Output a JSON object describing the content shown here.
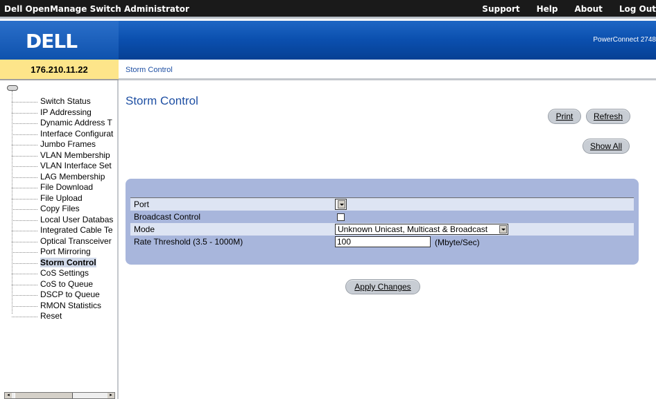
{
  "app": {
    "title": "Dell OpenManage Switch Administrator",
    "top_links": [
      "Support",
      "Help",
      "About",
      "Log Out"
    ],
    "logo": "DELL",
    "product": "PowerConnect 2748"
  },
  "device_ip": "176.210.11.22",
  "breadcrumb": "Storm Control",
  "nav": {
    "items": [
      "Switch Status",
      "IP Addressing",
      "Dynamic Address T",
      "Interface Configurat",
      "Jumbo Frames",
      "VLAN Membership",
      "VLAN Interface Set",
      "LAG Membership",
      "File Download",
      "File Upload",
      "Copy Files",
      "Local User Databas",
      "Integrated Cable Te",
      "Optical Transceiver",
      "Port Mirroring",
      "Storm Control",
      "CoS Settings",
      "CoS to Queue",
      "DSCP to Queue",
      "RMON Statistics",
      "Reset"
    ],
    "active": "Storm Control"
  },
  "main": {
    "title": "Storm Control",
    "buttons": {
      "print": "Print",
      "refresh": "Refresh",
      "show_all": "Show All",
      "apply": "Apply Changes"
    },
    "form": {
      "port_label": "Port",
      "port_value": "",
      "broadcast_label": "Broadcast Control",
      "broadcast_checked": false,
      "mode_label": "Mode",
      "mode_value": "Unknown Unicast, Multicast & Broadcast",
      "rate_label": "Rate Threshold (3.5 - 1000M)",
      "rate_value": "100",
      "rate_unit": "(Mbyte/Sec)"
    }
  },
  "colors": {
    "topbar": "#1a1a1a",
    "banner": "#0b4fae",
    "ip_box": "#fde58a",
    "link_blue": "#1e4fa3",
    "panel": "#a8b6dc",
    "row_light": "#dde4f3"
  }
}
